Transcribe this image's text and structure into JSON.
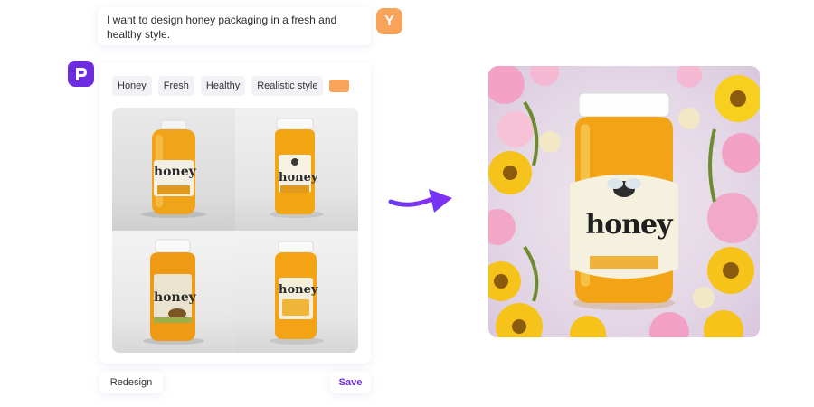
{
  "prompt": {
    "text": "I want to design honey packaging in a fresh and healthy style.",
    "user_avatar_letter": "Y"
  },
  "result": {
    "tags": [
      "Honey",
      "Fresh",
      "Healthy",
      "Realistic style"
    ],
    "color_swatch": "#f7a45a",
    "tiles": [
      {
        "jar_text": "honey"
      },
      {
        "jar_text": "honey"
      },
      {
        "jar_text": "honey"
      },
      {
        "jar_text": "honey"
      }
    ]
  },
  "actions": {
    "redesign_label": "Redesign",
    "save_label": "Save"
  },
  "hero": {
    "jar_text": "honey"
  },
  "colors": {
    "brand": "#6d2ce0",
    "accent": "#f7a45a",
    "arrow": "#7a2cf0"
  },
  "icons": [
    "app-logo-icon",
    "arrow-right-icon"
  ]
}
